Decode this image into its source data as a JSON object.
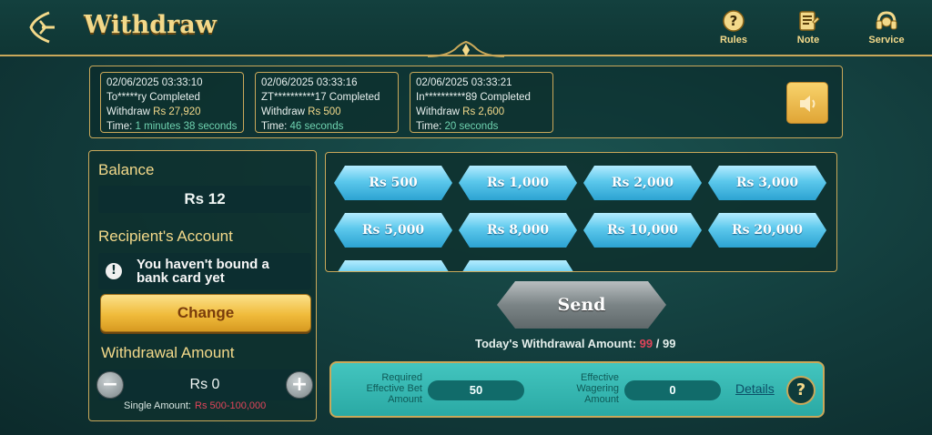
{
  "header": {
    "title": "Withdraw",
    "items": [
      {
        "label": "Rules",
        "icon": "question-icon"
      },
      {
        "label": "Note",
        "icon": "note-icon"
      },
      {
        "label": "Service",
        "icon": "headset-icon"
      }
    ]
  },
  "ticker": [
    {
      "datetime": "02/06/2025 03:33:10",
      "line": "To*****ry Completed",
      "withdraw_label": "Withdraw",
      "amount": "Rs 27,920",
      "time_label": "Time:",
      "time_value": "1 minutes 38 seconds"
    },
    {
      "datetime": "02/06/2025 03:33:16",
      "line": "ZT**********17 Completed",
      "withdraw_label": "Withdraw",
      "amount": "Rs 500",
      "time_label": "Time:",
      "time_value": "46 seconds"
    },
    {
      "datetime": "02/06/2025 03:33:21",
      "line": "In**********89 Completed",
      "withdraw_label": "Withdraw",
      "amount": "Rs 2,600",
      "time_label": "Time:",
      "time_value": "20 seconds"
    }
  ],
  "left": {
    "balance_title": "Balance",
    "balance_value": "Rs 12",
    "recipient_title": "Recipient's Account",
    "warning_text": "You haven't bound a bank card yet",
    "change_label": "Change",
    "withdrawal_title": "Withdrawal Amount",
    "amount_value": "Rs 0",
    "single_amount_label": "Single Amount:",
    "single_amount_range": "Rs 500-100,000"
  },
  "amount_options": [
    "Rs 500",
    "Rs 1,000",
    "Rs 2,000",
    "Rs 3,000",
    "Rs 5,000",
    "Rs 8,000",
    "Rs 10,000",
    "Rs 20,000"
  ],
  "send_label": "Send",
  "today": {
    "label": "Today's Withdrawal Amount:",
    "current": "99",
    "separator": "/",
    "max": "99"
  },
  "wager": {
    "required_label_1": "Required",
    "required_label_2": "Effective Bet",
    "required_label_3": "Amount",
    "required_value": "50",
    "effective_label_1": "Effective",
    "effective_label_2": "Wagering",
    "effective_label_3": "Amount",
    "effective_value": "0",
    "details_label": "Details",
    "help_symbol": "?"
  },
  "colors": {
    "gold": "#f3d98a",
    "accent_red": "#e0445a",
    "teal_panel": "#2aa9a4",
    "blue_button": "#5cc8ec"
  }
}
